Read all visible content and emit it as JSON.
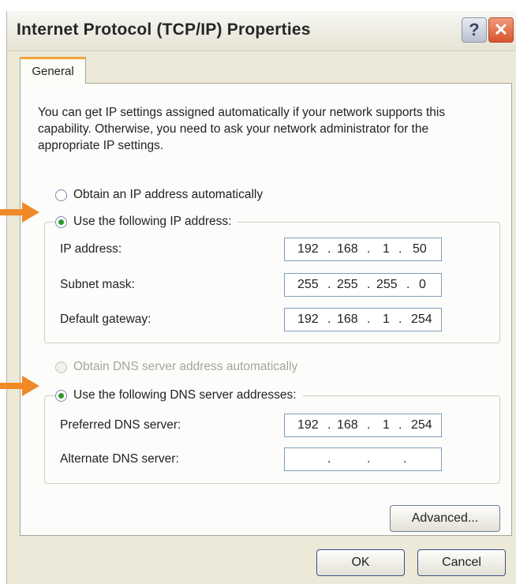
{
  "window": {
    "title": "Internet Protocol (TCP/IP) Properties",
    "help_label": "?",
    "close_label": "✕"
  },
  "tabs": [
    {
      "label": "General",
      "selected": true
    }
  ],
  "intro_text": "You can get IP settings assigned automatically if your network supports this capability. Otherwise, you need to ask your network administrator for the appropriate IP settings.",
  "ip_options": {
    "auto_label": "Obtain an IP address automatically",
    "manual_label": "Use the following IP address:",
    "selected": "manual"
  },
  "ip_fields": [
    {
      "label": "IP address:",
      "octets": [
        "192",
        "168",
        "1",
        "50"
      ]
    },
    {
      "label": "Subnet mask:",
      "octets": [
        "255",
        "255",
        "255",
        "0"
      ]
    },
    {
      "label": "Default gateway:",
      "octets": [
        "192",
        "168",
        "1",
        "254"
      ]
    }
  ],
  "dns_options": {
    "auto_label": "Obtain DNS server address automatically",
    "manual_label": "Use the following DNS server addresses:",
    "selected": "manual",
    "auto_disabled": true
  },
  "dns_fields": [
    {
      "label": "Preferred DNS server:",
      "octets": [
        "192",
        "168",
        "1",
        "254"
      ]
    },
    {
      "label": "Alternate DNS server:",
      "octets": [
        "",
        "",
        "",
        ""
      ]
    }
  ],
  "buttons": {
    "advanced": "Advanced...",
    "ok": "OK",
    "cancel": "Cancel"
  },
  "colors": {
    "annotation_arrow": "#f08a28",
    "radio_selected": "#2d9a2d",
    "tab_accent": "#f2a33a"
  },
  "icons": {
    "help": "help-icon",
    "close": "close-icon",
    "arrow": "arrow-right-icon"
  }
}
